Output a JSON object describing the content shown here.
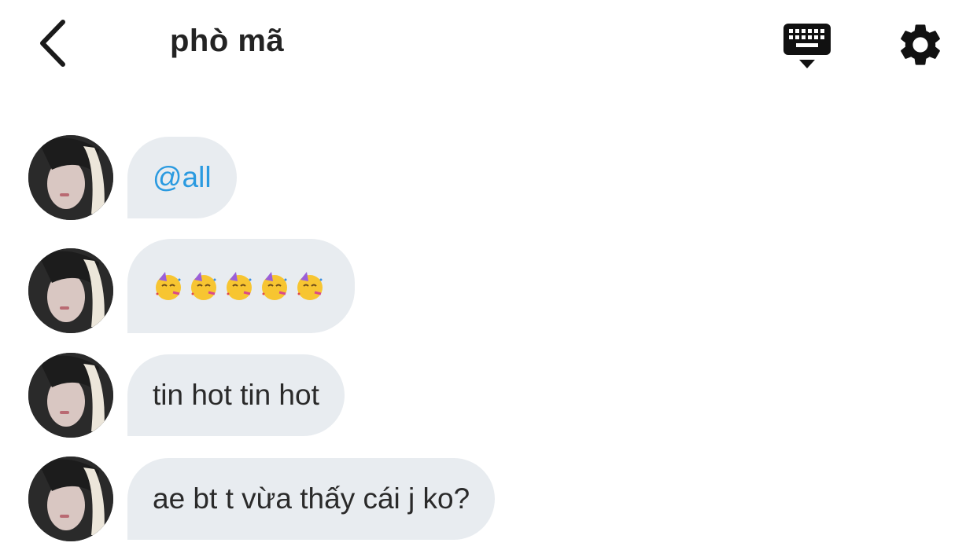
{
  "header": {
    "title": "phò mã",
    "back_icon": "chevron-left-icon",
    "keyboard_icon": "keyboard-hide-icon",
    "settings_icon": "gear-icon"
  },
  "messages": [
    {
      "type": "text",
      "text": "@all",
      "style": "mention"
    },
    {
      "type": "emoji",
      "emoji": "partying-face",
      "count": 5
    },
    {
      "type": "text",
      "text": "tin hot tin hot"
    },
    {
      "type": "text",
      "text": "ae bt t vừa thấy cái j ko?"
    }
  ],
  "colors": {
    "bubble_bg": "#e8ecf0",
    "mention": "#2a9ae0",
    "text": "#2a2a2a"
  }
}
